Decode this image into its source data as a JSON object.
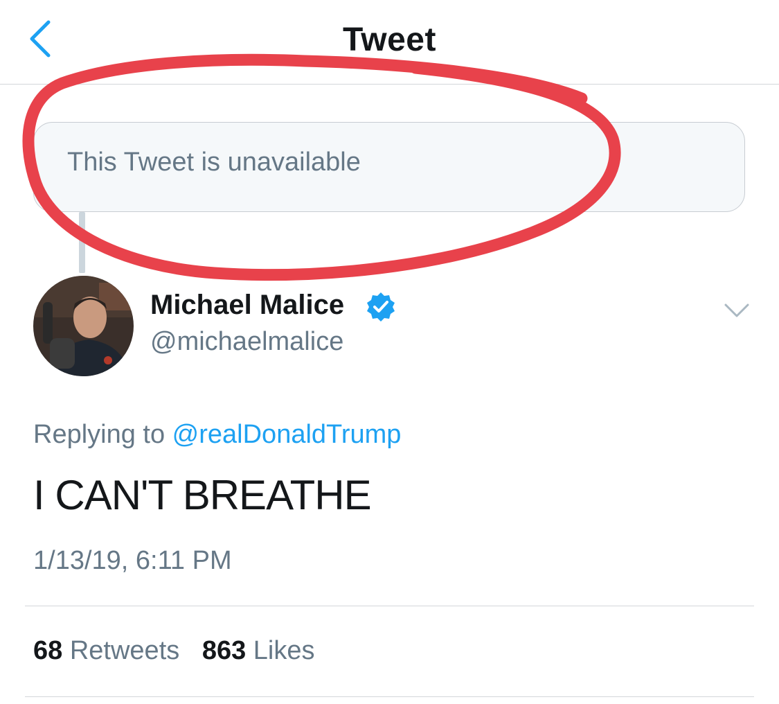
{
  "header": {
    "title": "Tweet",
    "back_icon": "chevron-left-icon"
  },
  "quoted_tweet": {
    "text": "This Tweet is unavailable"
  },
  "author": {
    "name": "Michael Malice",
    "handle": "@michaelmalice",
    "verified": true,
    "verified_icon": "verified-badge-icon"
  },
  "tweet": {
    "replying_prefix": "Replying to ",
    "replying_to": "@realDonaldTrump",
    "text": "I CAN'T BREATHE",
    "timestamp": "1/13/19, 6:11 PM"
  },
  "stats": {
    "retweets_count": "68",
    "retweets_label": "Retweets",
    "likes_count": "863",
    "likes_label": "Likes"
  },
  "colors": {
    "accent_blue": "#1da1f2",
    "secondary_text": "#657786",
    "annotation_red": "#e8424b"
  }
}
